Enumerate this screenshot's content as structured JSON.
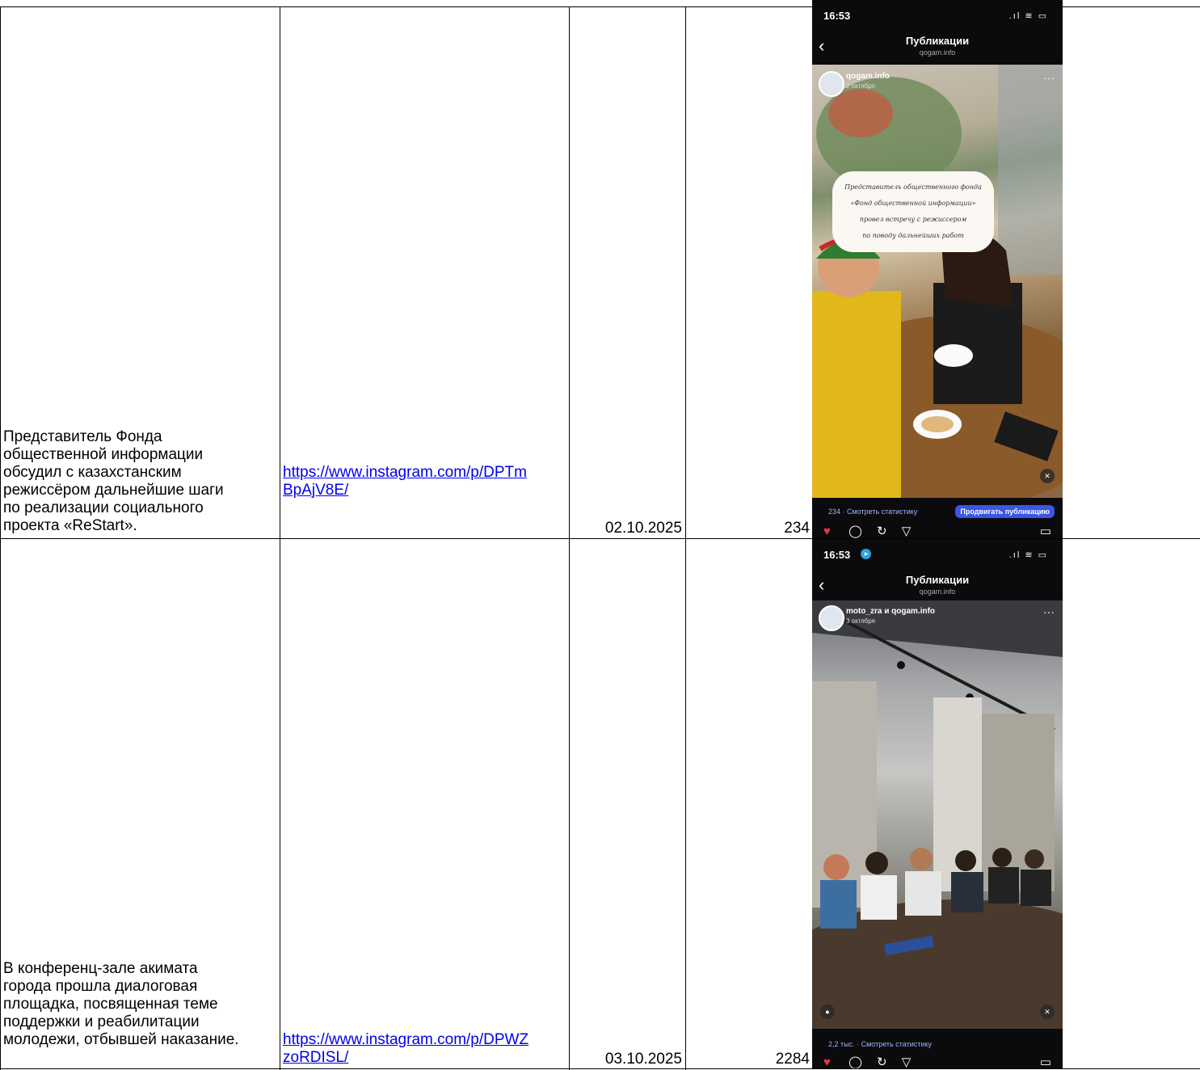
{
  "rows": [
    {
      "description": "Представитель Фонда\nобщественной информации\nобсудил с казахстанским\nрежиссёром дальнейшие шаги\nпо реализации социального\nпроекта «ReStart».",
      "link": "https://www.instagram.com/p/DPTm\nBpAjV8E/",
      "date": "02.10.2025",
      "views": "234",
      "phone": {
        "time": "16:53",
        "nav_title": "Публикации",
        "nav_sub": "qogam.info",
        "author": "qogam.info",
        "post_date": "2 октября",
        "quote": "Представитель общественного фонда\n«Фонд общественной информации»\nпровел встречу с режиссером\nпо поводу дальнейших работ",
        "stats": "234 · Смотреть статистику",
        "promo": "Продвигать публикацию"
      }
    },
    {
      "description": "В конференц-зале акимата\nгорода прошла диалоговая\nплощадка, посвященная теме\nподдержки и реабилитации\nмолодежи, отбывшей наказание.",
      "link": "https://www.instagram.com/p/DPWZ\nzoRDISL/",
      "date": "03.10.2025",
      "views": "2284",
      "phone": {
        "time": "16:53",
        "nav_title": "Публикации",
        "nav_sub": "qogam.info",
        "author": "moto_zra и qogam.info",
        "post_date": "3 октября",
        "stats": "2,2 тыс. · Смотреть статистику"
      }
    }
  ]
}
